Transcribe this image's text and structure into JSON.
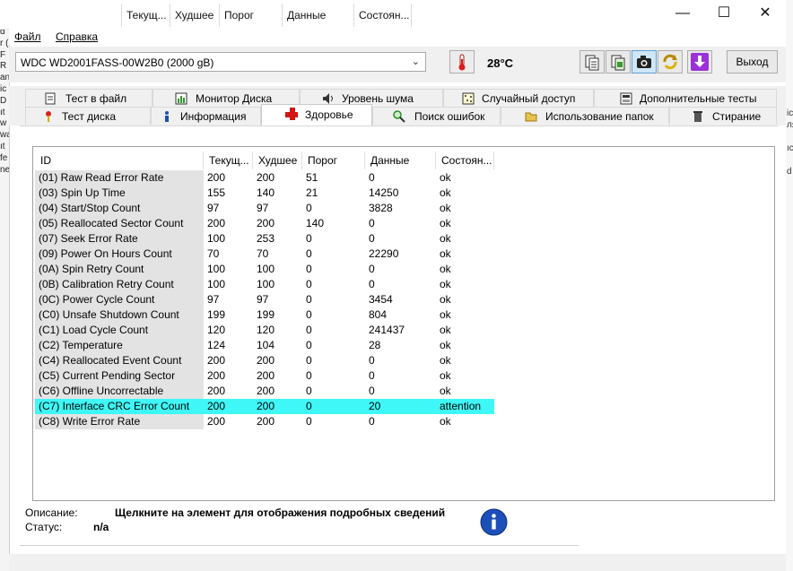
{
  "background": {
    "column_headers": [
      "Текущ...",
      "Худшее",
      "Порог",
      "Данные",
      "Состоян..."
    ],
    "left_fragments": [
      "d",
      "r (",
      "F",
      "R",
      "an",
      "ic",
      "D",
      "ıt",
      "w",
      "wa",
      "ıt",
      "fe",
      "ne"
    ],
    "right_fragments": [
      "іс",
      "ля",
      "",
      "ıc",
      "",
      "d"
    ]
  },
  "window": {
    "minimize": "—",
    "maximize": "☐",
    "close": "✕"
  },
  "menu": {
    "file": "Файл",
    "help": "Справка"
  },
  "toolbar": {
    "drive": "WDC WD2001FASS-00W2B0 (2000 gB)",
    "temperature": "28°C",
    "exit": "Выход",
    "icons": [
      "copy-text-icon",
      "copy-image-icon",
      "camera-icon",
      "refresh-icon",
      "save-down-icon"
    ]
  },
  "tabs": {
    "row1": [
      "Тест в файл",
      "Монитор Диска",
      "Уровень шума",
      "Случайный доступ",
      "Дополнительные  тесты"
    ],
    "row2": [
      "Тест диска",
      "Информация",
      "Здоровье",
      "Поиск ошибок",
      "Использование папок",
      "Стирание"
    ],
    "active": "Здоровье"
  },
  "table": {
    "headers": [
      "ID",
      "Текущ...",
      "Худшее",
      "Порог",
      "Данные",
      "Состоян..."
    ],
    "rows": [
      [
        "(01) Raw Read Error Rate",
        "200",
        "200",
        "51",
        "0",
        "ok"
      ],
      [
        "(03) Spin Up Time",
        "155",
        "140",
        "21",
        "14250",
        "ok"
      ],
      [
        "(04) Start/Stop Count",
        "97",
        "97",
        "0",
        "3828",
        "ok"
      ],
      [
        "(05) Reallocated Sector Count",
        "200",
        "200",
        "140",
        "0",
        "ok"
      ],
      [
        "(07) Seek Error Rate",
        "100",
        "253",
        "0",
        "0",
        "ok"
      ],
      [
        "(09) Power On Hours Count",
        "70",
        "70",
        "0",
        "22290",
        "ok"
      ],
      [
        "(0A) Spin Retry Count",
        "100",
        "100",
        "0",
        "0",
        "ok"
      ],
      [
        "(0B) Calibration Retry Count",
        "100",
        "100",
        "0",
        "0",
        "ok"
      ],
      [
        "(0C) Power Cycle Count",
        "97",
        "97",
        "0",
        "3454",
        "ok"
      ],
      [
        "(C0) Unsafe Shutdown Count",
        "199",
        "199",
        "0",
        "804",
        "ok"
      ],
      [
        "(C1) Load Cycle Count",
        "120",
        "120",
        "0",
        "241437",
        "ok"
      ],
      [
        "(C2) Temperature",
        "124",
        "104",
        "0",
        "28",
        "ok"
      ],
      [
        "(C4) Reallocated Event Count",
        "200",
        "200",
        "0",
        "0",
        "ok"
      ],
      [
        "(C5) Current Pending Sector",
        "200",
        "200",
        "0",
        "0",
        "ok"
      ],
      [
        "(C6) Offline Uncorrectable",
        "200",
        "200",
        "0",
        "0",
        "ok"
      ],
      [
        "(C7) Interface CRC Error Count",
        "200",
        "200",
        "0",
        "20",
        "attention"
      ],
      [
        "(C8) Write Error Rate",
        "200",
        "200",
        "0",
        "0",
        "ok"
      ]
    ],
    "selected_row": 15,
    "selected_color": "#3ff7f7"
  },
  "description": {
    "label": "Описание:",
    "text": "Щелкните на элемент для отображения подробных сведений",
    "status_label": "Статус:",
    "status_value": "n/a"
  }
}
